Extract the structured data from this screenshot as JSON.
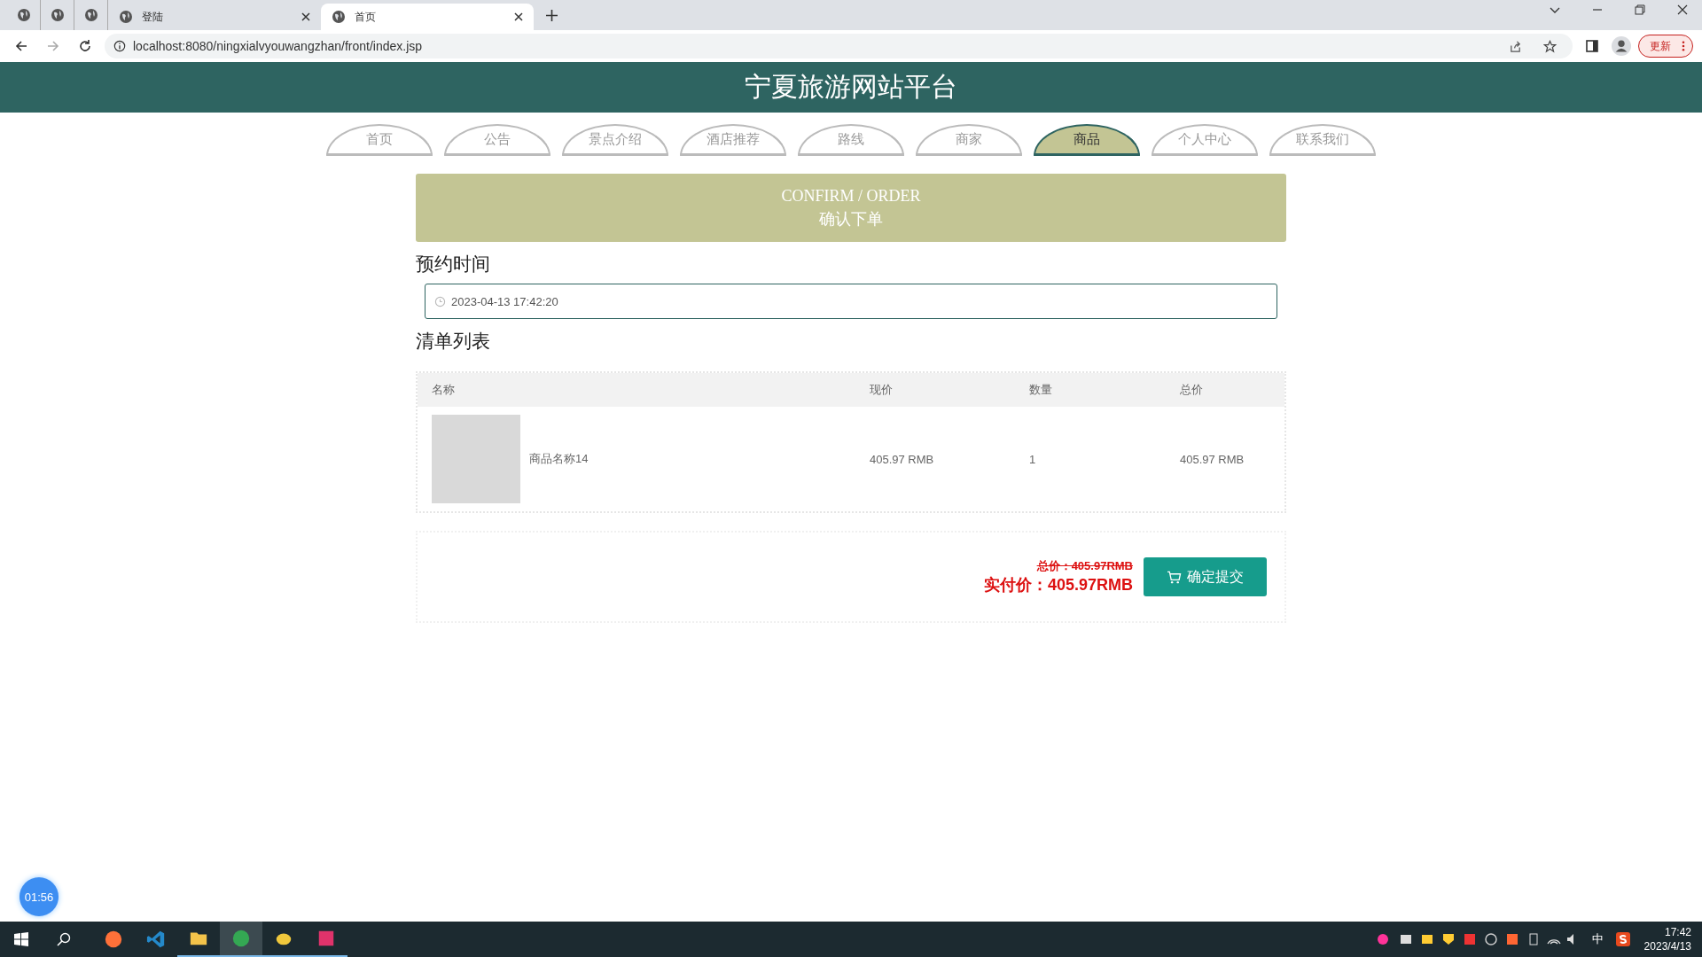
{
  "browser": {
    "tabs": [
      {
        "kind": "pinned",
        "selected": false
      },
      {
        "kind": "pinned",
        "selected": false
      },
      {
        "kind": "pinned",
        "selected": false
      },
      {
        "kind": "page",
        "title": "登陆",
        "selected": false
      },
      {
        "kind": "page",
        "title": "首页",
        "selected": true
      }
    ],
    "address": "localhost:8080/ningxialvyouwangzhan/front/index.jsp",
    "update_button": "更新"
  },
  "site_title": "宁夏旅游网站平台",
  "nav": [
    {
      "label": "首页",
      "selected": false
    },
    {
      "label": "公告",
      "selected": false
    },
    {
      "label": "景点介绍",
      "selected": false
    },
    {
      "label": "酒店推荐",
      "selected": false
    },
    {
      "label": "路线",
      "selected": false
    },
    {
      "label": "商家",
      "selected": false
    },
    {
      "label": "商品",
      "selected": true
    },
    {
      "label": "个人中心",
      "selected": false
    },
    {
      "label": "联系我们",
      "selected": false
    }
  ],
  "banner": {
    "title_en": "CONFIRM / ORDER",
    "title_zh": "确认下单"
  },
  "booking": {
    "label": "预约时间",
    "value": "2023-04-13 17:42:20"
  },
  "list": {
    "title": "清单列表",
    "columns": [
      "名称",
      "现价",
      "数量",
      "总价"
    ],
    "rows": [
      {
        "name": "商品名称14",
        "price": "405.97 RMB",
        "quantity": "1",
        "total": "405.97 RMB"
      }
    ]
  },
  "summary": {
    "total": "总价：405.97RMB",
    "paid": "实付价：405.97RMB",
    "submit": "确定提交"
  },
  "timer": "01:56",
  "taskbar": {
    "apps": [
      {
        "kind": "firefox",
        "selected": false,
        "running": false
      },
      {
        "kind": "vscode",
        "selected": false,
        "running": false
      },
      {
        "kind": "folder",
        "selected": false,
        "running": true
      },
      {
        "kind": "chrome",
        "selected": true,
        "running": true
      },
      {
        "kind": "duck",
        "selected": false,
        "running": true
      },
      {
        "kind": "ide",
        "selected": false,
        "running": true
      }
    ],
    "ime": "中",
    "time": "17:42",
    "date": "2023/4/13"
  }
}
